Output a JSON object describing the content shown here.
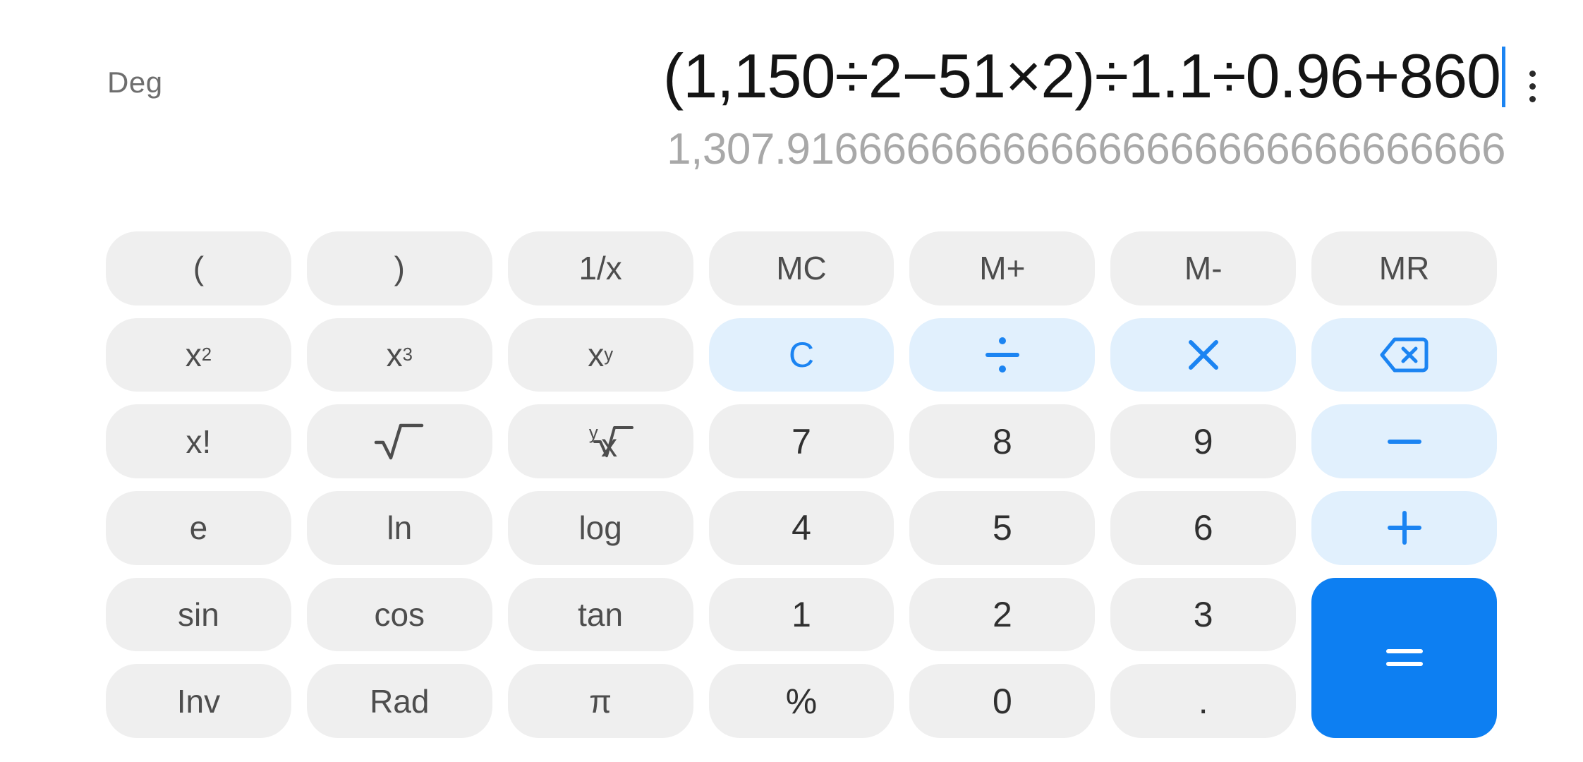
{
  "app": {
    "name": "Calculator",
    "mode_label": "Deg",
    "accent_blue": "#0d7ff2",
    "op_blue_text": "#1b84f2",
    "op_blue_bg": "#e1f0fd",
    "key_bg": "#efefef",
    "key_text": "#4d4d4d",
    "result_text": "#a8a8a8",
    "expression_text": "#141414"
  },
  "display": {
    "expression": "(1,150÷2−51×2)÷1.1÷0.96+860",
    "result": "1,307.916666666666666666666666666666",
    "cursor_visible": true,
    "menu_icon": "kebab-menu-icon"
  },
  "keypad": {
    "rows": [
      [
        {
          "id": "paren-open",
          "label": "(",
          "type": "fn",
          "icon": null
        },
        {
          "id": "paren-close",
          "label": ")",
          "type": "fn",
          "icon": null
        },
        {
          "id": "reciprocal",
          "label": "1/x",
          "type": "fn",
          "icon": null
        },
        {
          "id": "memory-clear",
          "label": "MC",
          "type": "fn",
          "icon": null
        },
        {
          "id": "memory-add",
          "label": "M+",
          "type": "fn",
          "icon": null
        },
        {
          "id": "memory-sub",
          "label": "M-",
          "type": "fn",
          "icon": null
        },
        {
          "id": "memory-recall",
          "label": "MR",
          "type": "fn",
          "icon": null
        }
      ],
      [
        {
          "id": "x-squared",
          "label": "x²",
          "type": "fn",
          "icon": null,
          "base": "x",
          "exp": "2"
        },
        {
          "id": "x-cubed",
          "label": "x³",
          "type": "fn",
          "icon": null,
          "base": "x",
          "exp": "3"
        },
        {
          "id": "x-power-y",
          "label": "xʸ",
          "type": "fn",
          "icon": null,
          "base": "x",
          "exp": "y"
        },
        {
          "id": "clear",
          "label": "C",
          "type": "op",
          "icon": null
        },
        {
          "id": "divide",
          "label": "÷",
          "type": "op",
          "icon": "divide-icon"
        },
        {
          "id": "multiply",
          "label": "×",
          "type": "op",
          "icon": "multiply-icon"
        },
        {
          "id": "backspace",
          "label": "",
          "type": "op",
          "icon": "backspace-icon"
        }
      ],
      [
        {
          "id": "factorial",
          "label": "x!",
          "type": "fn",
          "icon": null
        },
        {
          "id": "square-root",
          "label": "√",
          "type": "fn",
          "icon": "square-root-icon"
        },
        {
          "id": "nth-root",
          "label": "ʸ√x",
          "type": "fn",
          "icon": "nth-root-icon",
          "pre": "y",
          "base": "x"
        },
        {
          "id": "digit-7",
          "label": "7",
          "type": "num",
          "icon": null
        },
        {
          "id": "digit-8",
          "label": "8",
          "type": "num",
          "icon": null
        },
        {
          "id": "digit-9",
          "label": "9",
          "type": "num",
          "icon": null
        },
        {
          "id": "subtract",
          "label": "−",
          "type": "op",
          "icon": "minus-icon"
        }
      ],
      [
        {
          "id": "euler",
          "label": "e",
          "type": "fn",
          "icon": null
        },
        {
          "id": "natural-log",
          "label": "ln",
          "type": "fn",
          "icon": null
        },
        {
          "id": "log",
          "label": "log",
          "type": "fn",
          "icon": null
        },
        {
          "id": "digit-4",
          "label": "4",
          "type": "num",
          "icon": null
        },
        {
          "id": "digit-5",
          "label": "5",
          "type": "num",
          "icon": null
        },
        {
          "id": "digit-6",
          "label": "6",
          "type": "num",
          "icon": null
        },
        {
          "id": "add",
          "label": "+",
          "type": "op",
          "icon": "plus-icon"
        }
      ],
      [
        {
          "id": "sin",
          "label": "sin",
          "type": "fn",
          "icon": null
        },
        {
          "id": "cos",
          "label": "cos",
          "type": "fn",
          "icon": null
        },
        {
          "id": "tan",
          "label": "tan",
          "type": "fn",
          "icon": null
        },
        {
          "id": "digit-1",
          "label": "1",
          "type": "num",
          "icon": null
        },
        {
          "id": "digit-2",
          "label": "2",
          "type": "num",
          "icon": null
        },
        {
          "id": "digit-3",
          "label": "3",
          "type": "num",
          "icon": null
        },
        {
          "id": "equals",
          "label": "=",
          "type": "equals",
          "icon": "equals-icon"
        }
      ],
      [
        {
          "id": "inverse",
          "label": "Inv",
          "type": "fn",
          "icon": null
        },
        {
          "id": "radian",
          "label": "Rad",
          "type": "fn",
          "icon": null
        },
        {
          "id": "pi",
          "label": "π",
          "type": "fn",
          "icon": null
        },
        {
          "id": "percent",
          "label": "%",
          "type": "num",
          "icon": null
        },
        {
          "id": "digit-0",
          "label": "0",
          "type": "num",
          "icon": null
        },
        {
          "id": "decimal-point",
          "label": ".",
          "type": "num",
          "icon": null
        }
      ]
    ]
  }
}
